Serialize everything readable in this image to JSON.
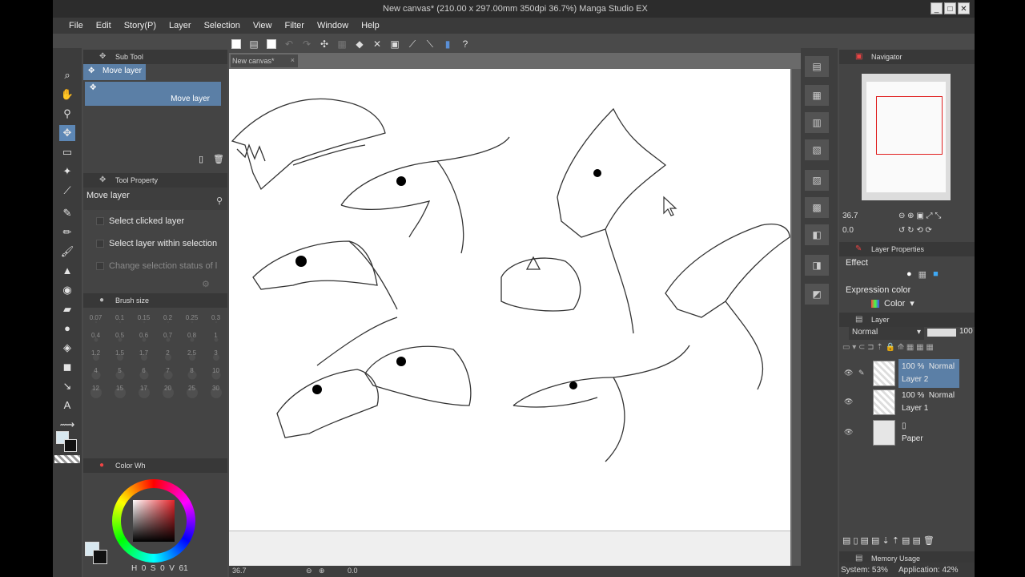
{
  "window": {
    "title": "New canvas* (210.00 x 297.00mm 350dpi 36.7%)   Manga Studio EX",
    "controls": [
      "_",
      "□",
      "✕"
    ]
  },
  "menu": [
    "File",
    "Edit",
    "Story(P)",
    "Layer",
    "Selection",
    "View",
    "Filter",
    "Window",
    "Help"
  ],
  "sub_tool": {
    "header": "Sub Tool",
    "active_tab": "Move layer",
    "item": "Move layer"
  },
  "tool_property": {
    "header": "Tool Property",
    "tool_name": "Move layer",
    "options": [
      {
        "label": "Select clicked layer",
        "enabled": true
      },
      {
        "label": "Select layer within selection",
        "enabled": true
      },
      {
        "label": "Change selection status of l",
        "enabled": false
      }
    ]
  },
  "brush_size": {
    "header": "Brush size",
    "sizes": [
      "0.07",
      "0.1",
      "0.15",
      "0.2",
      "0.25",
      "0.3",
      "0.4",
      "0.5",
      "0.6",
      "0.7",
      "0.8",
      "1",
      "1.2",
      "1.5",
      "1.7",
      "2",
      "2.5",
      "3",
      "4",
      "5",
      "6",
      "7",
      "8",
      "10",
      "12",
      "15",
      "17",
      "20",
      "25",
      "30"
    ]
  },
  "color_wheel": {
    "header": "Color Wh",
    "h_label": "H",
    "h_value": "0",
    "s_label": "S",
    "s_value": "0",
    "v_label": "V",
    "v_value": "61",
    "main_color": "#e4252b"
  },
  "document": {
    "tab": "New canvas*",
    "zoom": "36.7",
    "rotation": "0.0"
  },
  "navigator": {
    "header": "Navigator",
    "zoom": "36.7",
    "rotation": "0.0"
  },
  "layer_properties": {
    "header": "Layer Properties",
    "effect_label": "Effect",
    "expression_label": "Expression color",
    "expression_value": "Color"
  },
  "layers": {
    "header": "Layer",
    "blend_mode": "Normal",
    "opacity": "100",
    "items": [
      {
        "opacity": "100 %",
        "blend": "Normal",
        "name": "Layer 2",
        "selected": true
      },
      {
        "opacity": "100 %",
        "blend": "Normal",
        "name": "Layer 1",
        "selected": false
      },
      {
        "opacity": "",
        "blend": "",
        "name": "Paper",
        "selected": false
      }
    ]
  },
  "memory": {
    "header": "Memory Usage",
    "system": "System: 53%",
    "application": "Application: 42%"
  }
}
